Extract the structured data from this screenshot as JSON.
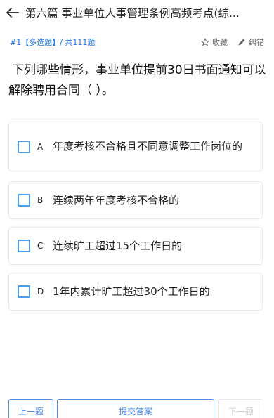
{
  "header": {
    "title": "第六篇  事业单位人事管理条例高频考点(综..."
  },
  "question": {
    "meta": "#1【多选题】/ 共111题",
    "favorite_label": "收藏",
    "report_label": "纠错",
    "text": "下列哪些情形，事业单位提前30日书面通知可以解除聘用合同（  ）。"
  },
  "options": [
    {
      "letter": "A",
      "text": "年度考核不合格且不同意调整工作岗位的"
    },
    {
      "letter": "B",
      "text": "连续两年年度考核不合格的"
    },
    {
      "letter": "C",
      "text": "连续旷工超过15个工作日的"
    },
    {
      "letter": "D",
      "text": "1年内累计旷工超过30个工作日的"
    }
  ],
  "footer": {
    "prev_label": "上一题",
    "submit_label": "提交答案",
    "next_label": "下一题"
  },
  "colors": {
    "accent": "#1a73e8",
    "checkbox_border": "#4a9ff0",
    "button_border": "#4a8be8",
    "disabled": "#cfcfcf"
  }
}
